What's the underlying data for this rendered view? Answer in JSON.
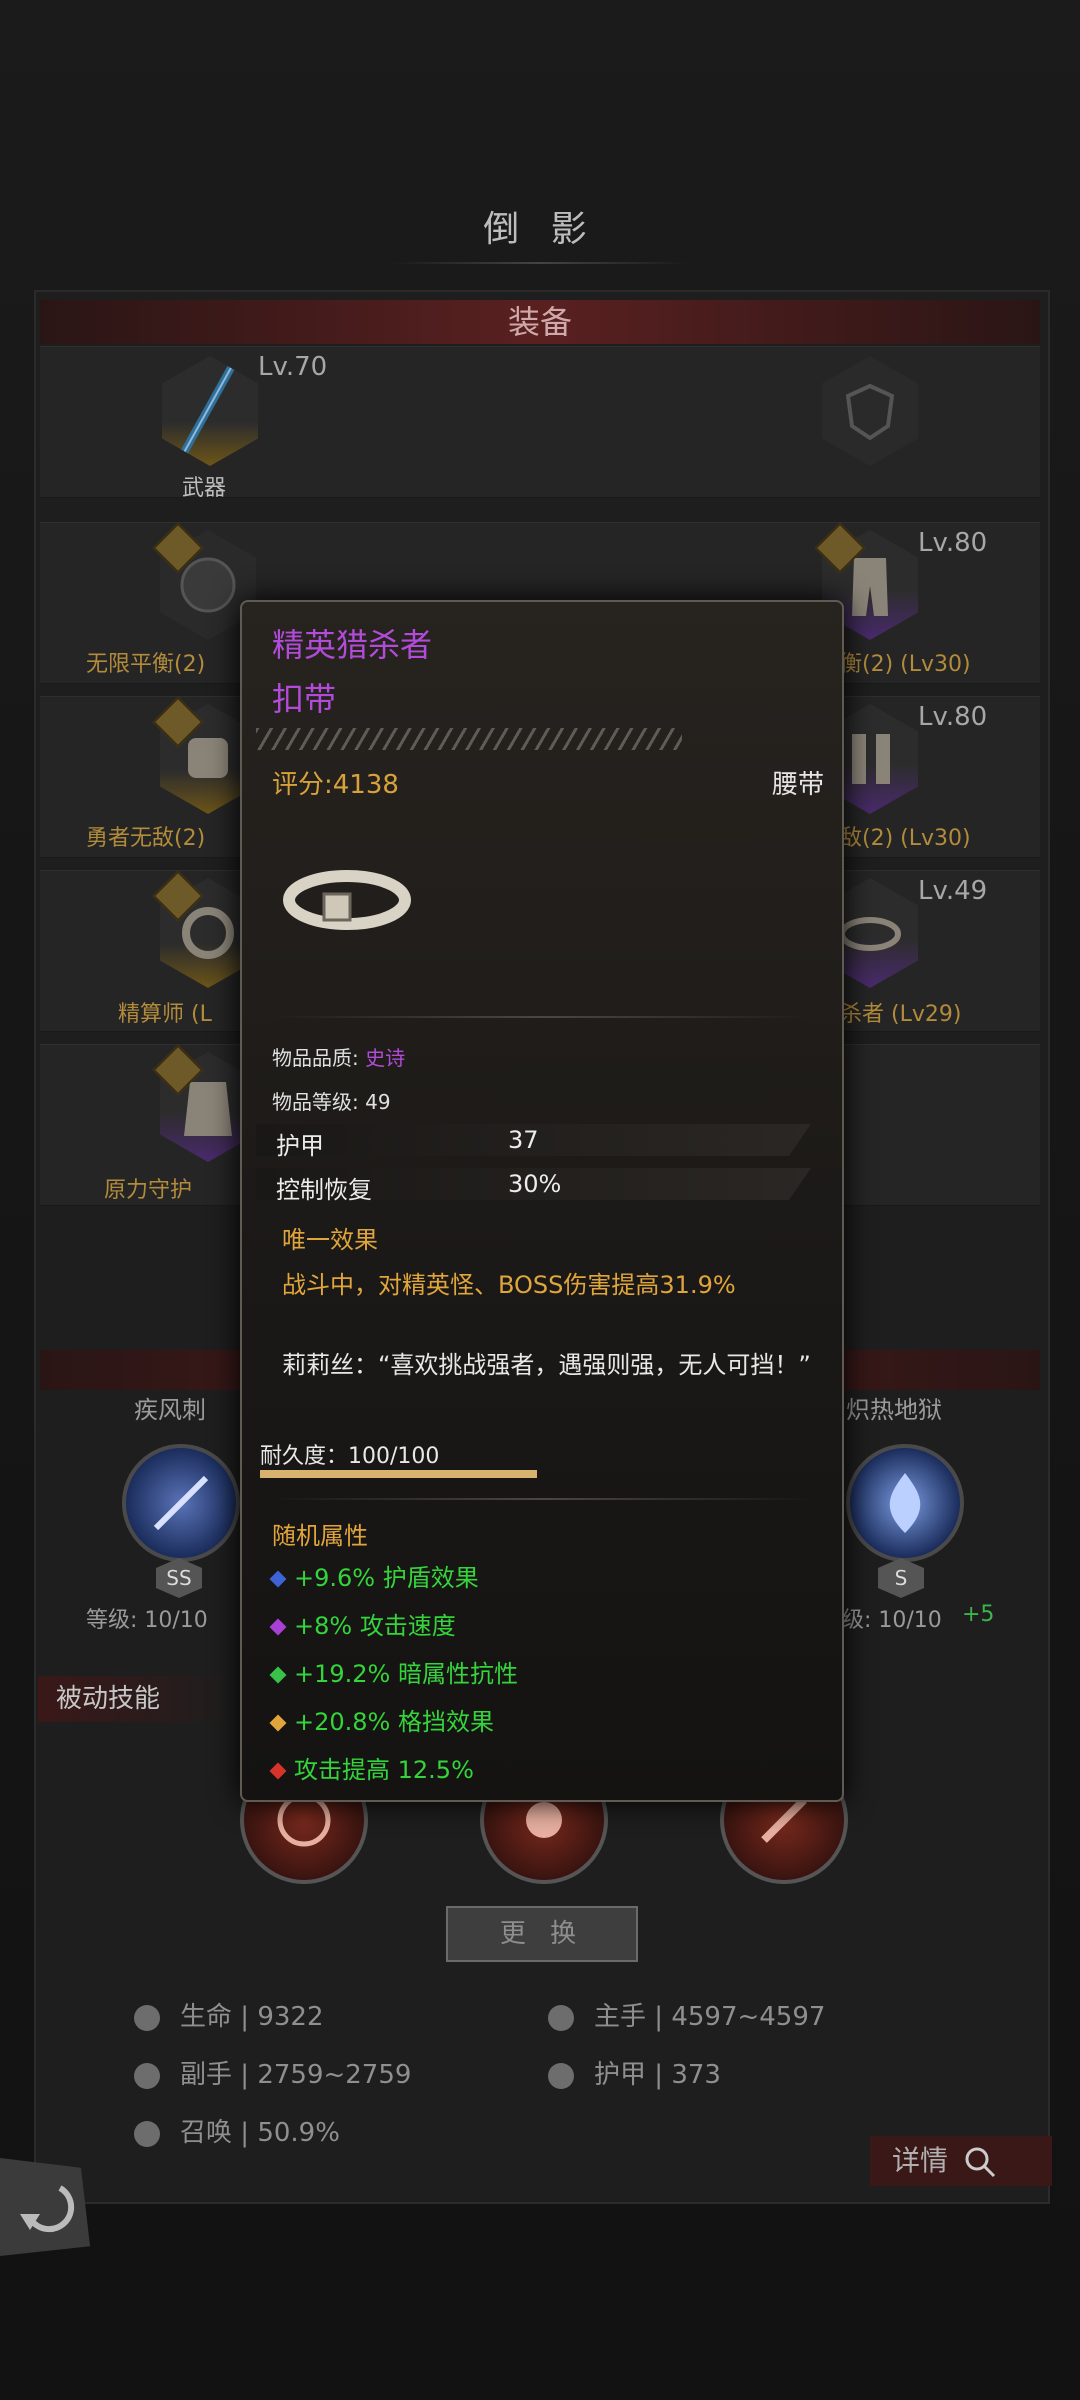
{
  "page": {
    "title": "倒 影",
    "equipment_header": "装备",
    "weapon": {
      "label": "武器",
      "level": "Lv.70"
    },
    "left_slots": [
      {
        "label": "无限平衡(2)"
      },
      {
        "label": "勇者无敌(2)"
      },
      {
        "label": "精算师 (L"
      },
      {
        "label": "原力守护"
      }
    ],
    "right_slots": [
      {
        "label": "衡(2)  (Lv30)",
        "level": "Lv.80"
      },
      {
        "label": "敌(2)  (Lv30)",
        "level": "Lv.80"
      },
      {
        "label": "杀者  (Lv29)",
        "level": "Lv.49"
      }
    ],
    "skills": {
      "left_name": "疾风刺",
      "left_level": "等级: 10/10",
      "left_grade": "SS",
      "right_name": "炽热地狱",
      "right_level": "级: 10/10",
      "right_bonus": "+5",
      "right_grade": "S"
    },
    "passive_header": "被动技能",
    "change_button": "更 换",
    "stats": [
      {
        "name": "生命",
        "value": "9322"
      },
      {
        "name": "主手",
        "value": "4597~4597"
      },
      {
        "name": "副手",
        "value": "2759~2759"
      },
      {
        "name": "护甲",
        "value": "373"
      },
      {
        "name": "召唤",
        "value": "50.9%"
      }
    ],
    "stat_sep": "|",
    "detail_button": "详情"
  },
  "tooltip": {
    "name": "精英猎杀者",
    "type": "扣带",
    "score": "评分:4138",
    "slot": "腰带",
    "quality_label": "物品品质: ",
    "quality_value": "史诗",
    "item_level": "物品等级: 49",
    "base_stats": [
      {
        "name": "护甲",
        "value": "37"
      },
      {
        "name": "控制恢复",
        "value": "30%"
      }
    ],
    "unique_title": "唯一效果",
    "unique_text": "战斗中，对精英怪、BOSS伤害提高31.9%",
    "quote": "莉莉丝：“喜欢挑战强者，遇强则强，无人可挡！”",
    "durability": "耐久度：100/100",
    "durability_fraction": 1.0,
    "random_title": "随机属性",
    "random_stats": [
      {
        "text": "+9.6% 护盾效果",
        "gem_color": "#3d63d6"
      },
      {
        "text": "+8% 攻击速度",
        "gem_color": "#a840d6"
      },
      {
        "text": "+19.2% 暗属性抗性",
        "gem_color": "#38c24a"
      },
      {
        "text": "+20.8% 格挡效果",
        "gem_color": "#e0a53b"
      },
      {
        "text": "攻击提高 12.5%",
        "gem_color": "#d6342b"
      }
    ]
  }
}
